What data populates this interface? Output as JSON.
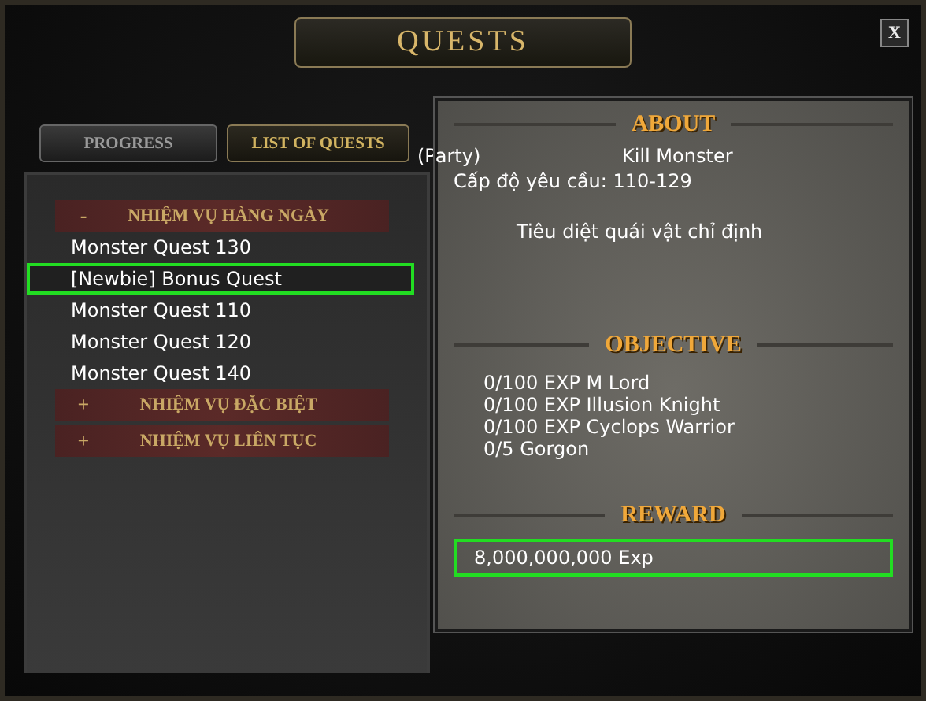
{
  "window": {
    "title": "QUESTS",
    "close": "X"
  },
  "tabs": [
    {
      "label": "PROGRESS",
      "selected": false
    },
    {
      "label": "LIST OF QUESTS",
      "selected": true
    }
  ],
  "quest_list": [
    {
      "sign": "-",
      "label": "NHIỆM VỤ HÀNG NGÀY",
      "expanded": true,
      "children": [
        {
          "label": "Monster Quest 130",
          "selected": false
        },
        {
          "label": "[Newbie] Bonus Quest",
          "selected": true
        },
        {
          "label": "Monster Quest 110",
          "selected": false
        },
        {
          "label": "Monster Quest 120",
          "selected": false
        },
        {
          "label": "Monster Quest 140",
          "selected": false
        }
      ]
    },
    {
      "sign": "+",
      "label": "NHIỆM VỤ ĐẶC BIỆT",
      "expanded": false
    },
    {
      "sign": "+",
      "label": "NHIỆM VỤ LIÊN TỤC",
      "expanded": false
    }
  ],
  "about": {
    "heading": "ABOUT",
    "type": "(Party)",
    "name": "Kill Monster",
    "level": "Cấp độ yêu cầu: 110-129",
    "description": "Tiêu diệt quái vật chỉ định"
  },
  "objective": {
    "heading": "OBJECTIVE",
    "items": [
      "0/100 EXP M Lord",
      "0/100 EXP Illusion Knight",
      "0/100 EXP Cyclops Warrior",
      "0/5 Gorgon"
    ]
  },
  "reward": {
    "heading": "REWARD",
    "items": [
      {
        "label": "8,000,000,000 Exp",
        "selected": true
      }
    ]
  }
}
